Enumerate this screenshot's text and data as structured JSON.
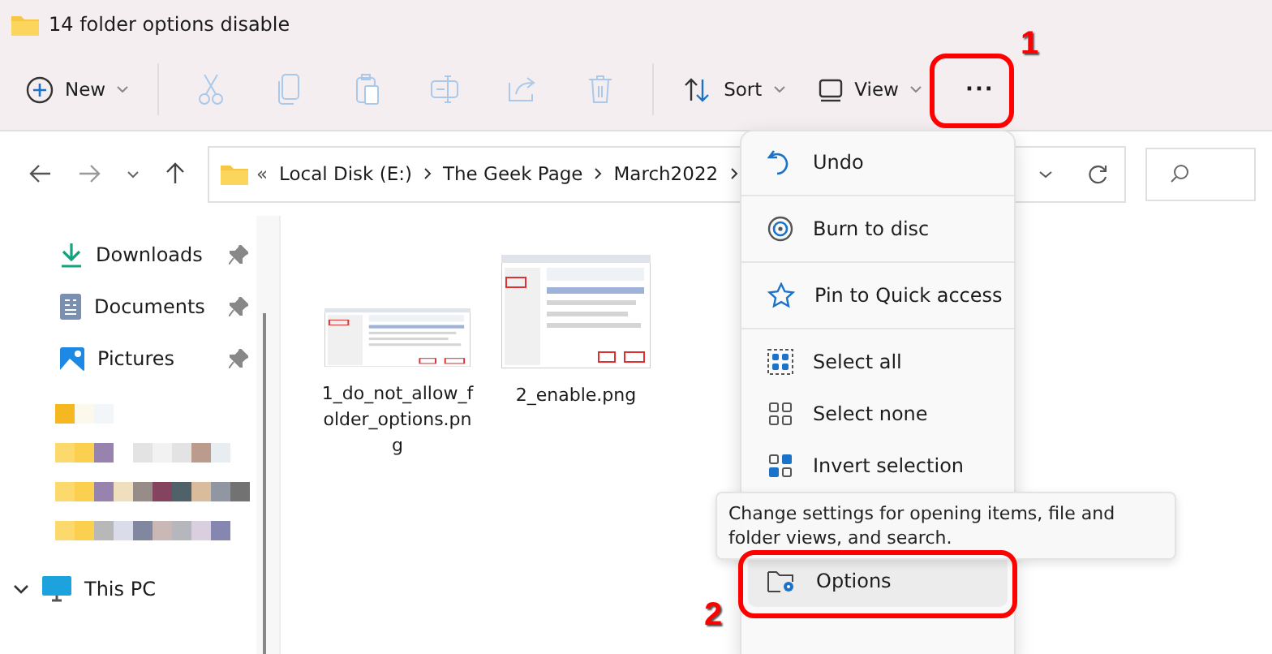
{
  "window": {
    "title": "14 folder options disable"
  },
  "toolbar": {
    "items": [
      {
        "kind": "new",
        "label": "New",
        "disabled": false
      },
      {
        "kind": "cut",
        "disabled": true
      },
      {
        "kind": "copy",
        "disabled": true
      },
      {
        "kind": "paste",
        "disabled": true
      },
      {
        "kind": "rename",
        "disabled": true
      },
      {
        "kind": "share",
        "disabled": true
      },
      {
        "kind": "delete",
        "disabled": true
      },
      {
        "kind": "sort",
        "label": "Sort",
        "disabled": false
      },
      {
        "kind": "view",
        "label": "View",
        "disabled": false
      },
      {
        "kind": "more",
        "label": "···",
        "disabled": false
      }
    ]
  },
  "address_bar": {
    "overflow": "«",
    "path": [
      "Local Disk (E:)",
      "The Geek Page",
      "March2022"
    ]
  },
  "sidebar": {
    "items": [
      {
        "kind": "downloads",
        "label": "Downloads",
        "pinned": true
      },
      {
        "kind": "documents",
        "label": "Documents",
        "pinned": true
      },
      {
        "kind": "pictures",
        "label": "Pictures",
        "pinned": true
      },
      {
        "kind": "blurred"
      },
      {
        "kind": "blurred"
      },
      {
        "kind": "blurred"
      },
      {
        "kind": "blurred"
      },
      {
        "kind": "pc",
        "label": "This PC",
        "expanded": true
      }
    ]
  },
  "files": [
    {
      "name": "1_do_not_allow_folder_options.png",
      "kind": "picture"
    },
    {
      "name": "2_enable.png",
      "kind": "picture"
    }
  ],
  "menu": {
    "groups": [
      [
        {
          "kind": "undo",
          "label": "Undo",
          "selected": false
        }
      ],
      [
        {
          "kind": "burn",
          "label": "Burn to disc",
          "selected": false
        }
      ],
      [
        {
          "kind": "pin",
          "label": "Pin to Quick access",
          "selected": false
        }
      ],
      [
        {
          "kind": "selectall",
          "label": "Select all",
          "selected": false
        },
        {
          "kind": "selectnone",
          "label": "Select none",
          "selected": false
        },
        {
          "kind": "invert",
          "label": "Invert selection",
          "selected": false
        },
        {
          "kind": "options",
          "label": "Options",
          "selected": true
        }
      ]
    ]
  },
  "tooltip": "Change settings for opening items, file and folder views, and search.",
  "annotations": [
    {
      "number": "1"
    },
    {
      "number": "2"
    }
  ]
}
